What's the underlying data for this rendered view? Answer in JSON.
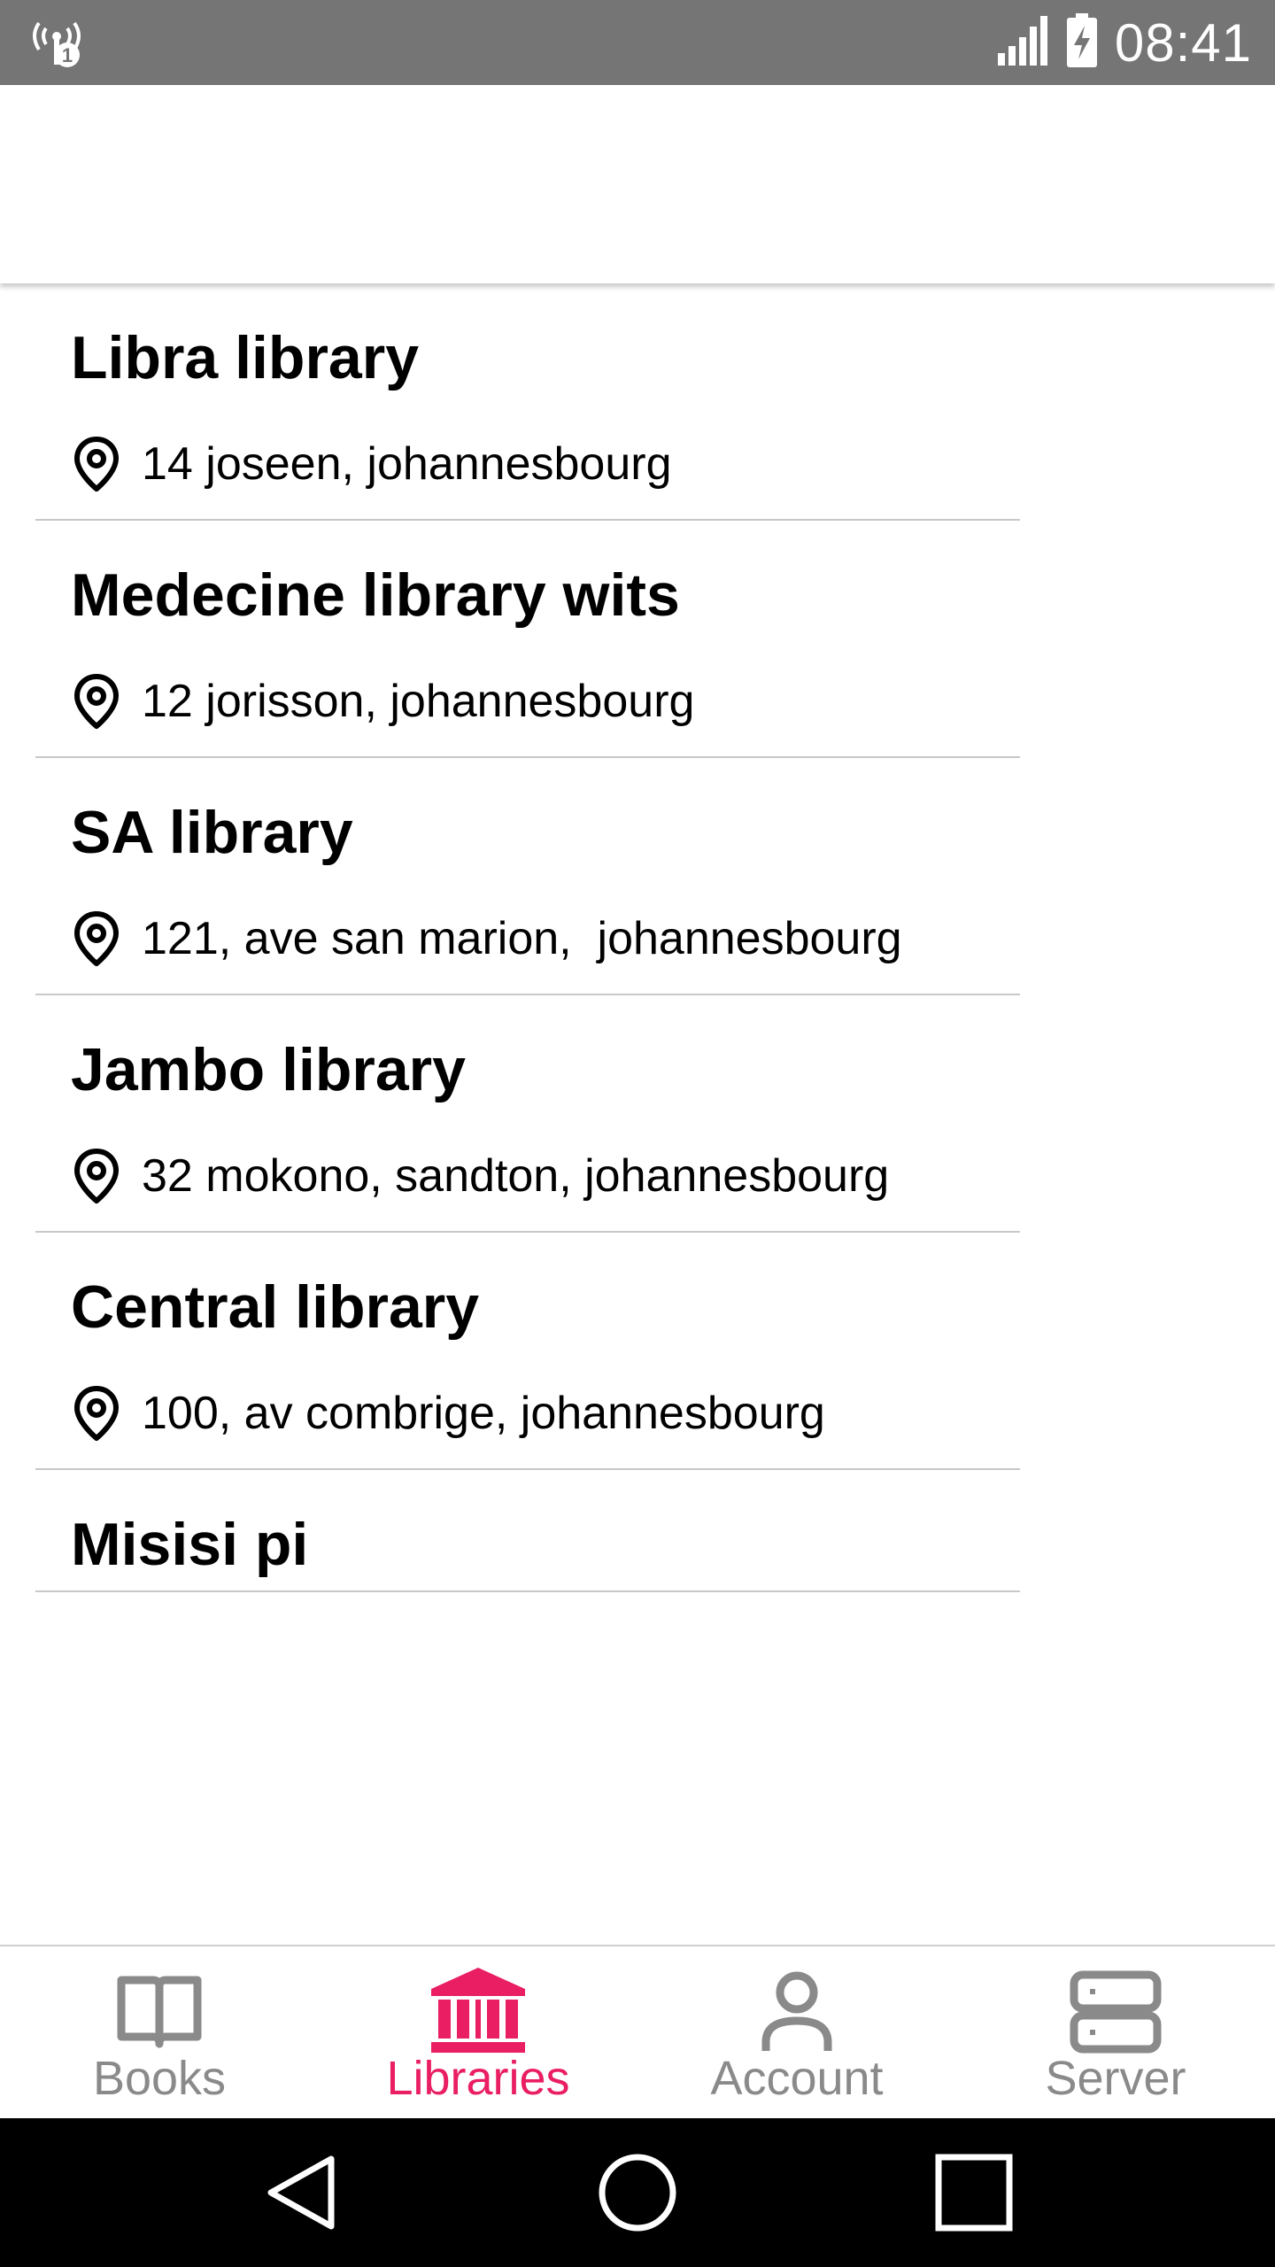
{
  "status_bar": {
    "time": "08:41",
    "icons": [
      "wireless-hotspot-icon",
      "signal-icon",
      "battery-charging-icon"
    ]
  },
  "libraries": [
    {
      "name": "Libra library",
      "address": "14 joseen, johannesbourg"
    },
    {
      "name": "Medecine library wits",
      "address": "12 jorisson, johannesbourg"
    },
    {
      "name": "SA library",
      "address": "121, ave san marion,  johannesbourg"
    },
    {
      "name": "Jambo library",
      "address": "32 mokono, sandton, johannesbourg"
    },
    {
      "name": "Central library",
      "address": "100, av combrige, johannesbourg"
    },
    {
      "name": "Misisi pi",
      "address": ""
    }
  ],
  "bottom_nav": {
    "items": [
      {
        "label": "Books",
        "icon": "book-icon",
        "active": false
      },
      {
        "label": "Libraries",
        "icon": "library-building-icon",
        "active": true
      },
      {
        "label": "Account",
        "icon": "person-icon",
        "active": false
      },
      {
        "label": "Server",
        "icon": "server-icon",
        "active": false
      }
    ]
  },
  "colors": {
    "accent": "#e91e63",
    "inactive": "#8a8a8a",
    "status_bar": "#757575",
    "system_nav": "#000000"
  },
  "system_nav": {
    "icons": [
      "back-icon",
      "home-icon",
      "recents-icon"
    ]
  }
}
